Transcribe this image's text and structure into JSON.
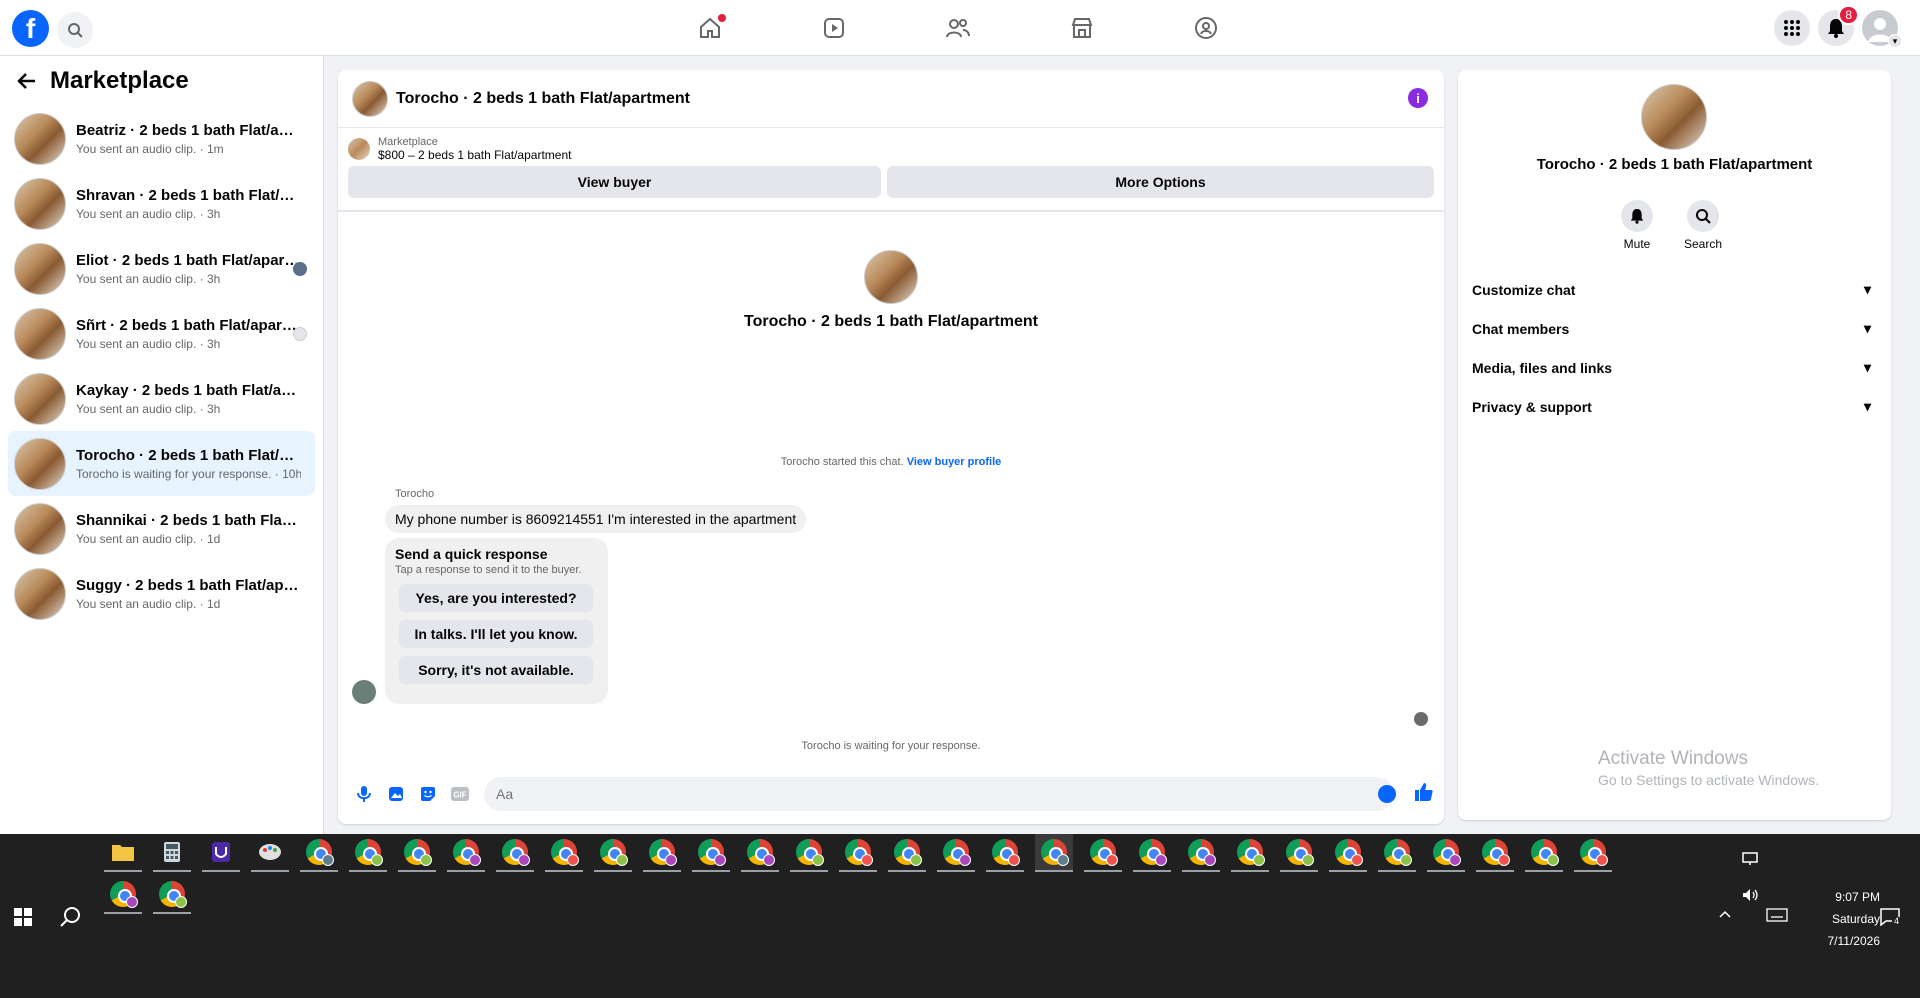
{
  "colors": {
    "brand": "#0866ff",
    "accent_purple": "#8a2be2",
    "badge": "#e41e3f",
    "active_row": "#e7f3ff"
  },
  "topbar": {
    "logo_letter": "f",
    "notifications_count": "8",
    "nav": [
      "home-icon",
      "video-icon",
      "friends-icon",
      "marketplace-icon",
      "groups-icon"
    ]
  },
  "sidebar": {
    "title": "Marketplace",
    "conversations": [
      {
        "name": "Beatriz · 2 beds 1 bath Flat/apartm...",
        "sub": "You sent an audio clip. · 1m"
      },
      {
        "name": "Shravan · 2 beds 1 bath Flat/apart...",
        "sub": "You sent an audio clip. · 3h"
      },
      {
        "name": "Eliot · 2 beds 1 bath Flat/apartm...",
        "sub": "You sent an audio clip. · 3h"
      },
      {
        "name": "Sñrt · 2 beds 1 bath Flat/apartm...",
        "sub": "You sent an audio clip. · 3h"
      },
      {
        "name": "Kaykay · 2 beds 1 bath Flat/apartm...",
        "sub": "You sent an audio clip. · 3h"
      },
      {
        "name": "Torocho · 2 beds 1 bath Flat/apart...",
        "sub": "Torocho is waiting for your response. · 10h"
      },
      {
        "name": "Shannikai · 2 beds 1 bath Flat/apar...",
        "sub": "You sent an audio clip. · 1d"
      },
      {
        "name": "Suggy · 2 beds 1 bath Flat/apartm...",
        "sub": "You sent an audio clip. · 1d"
      }
    ]
  },
  "chat": {
    "title": "Torocho · 2 beds 1 bath Flat/apartment",
    "listing_category": "Marketplace",
    "listing_price": "$800 – 2 beds 1 bath Flat/apartment",
    "view_buyer": "View buyer",
    "more_options": "More Options",
    "center_name": "Torocho · 2 beds 1 bath Flat/apartment",
    "started_text": "Torocho started this chat.",
    "view_profile": "View buyer profile",
    "sender": "Torocho",
    "message": "My phone number is 8609214551 I'm interested in the apartment",
    "quick_title": "Send a quick response",
    "quick_sub": "Tap a response to send it to the buyer.",
    "quick_replies": [
      "Yes, are you interested?",
      "In talks. I'll let you know.",
      "Sorry, it's not available."
    ],
    "waiting": "Torocho is waiting for your response.",
    "composer_placeholder": "Aa"
  },
  "info": {
    "name": "Torocho · 2 beds 1 bath Flat/apartment",
    "mute": "Mute",
    "search": "Search",
    "sections": [
      "Customize chat",
      "Chat members",
      "Media, files and links",
      "Privacy & support"
    ]
  },
  "watermark": {
    "line1": "Activate Windows",
    "line2": "Go to Settings to activate Windows."
  },
  "clock": {
    "time": "9:07 PM",
    "day": "Saturday",
    "date": "7/11/2026"
  },
  "tray": {
    "notification_count": "4"
  }
}
